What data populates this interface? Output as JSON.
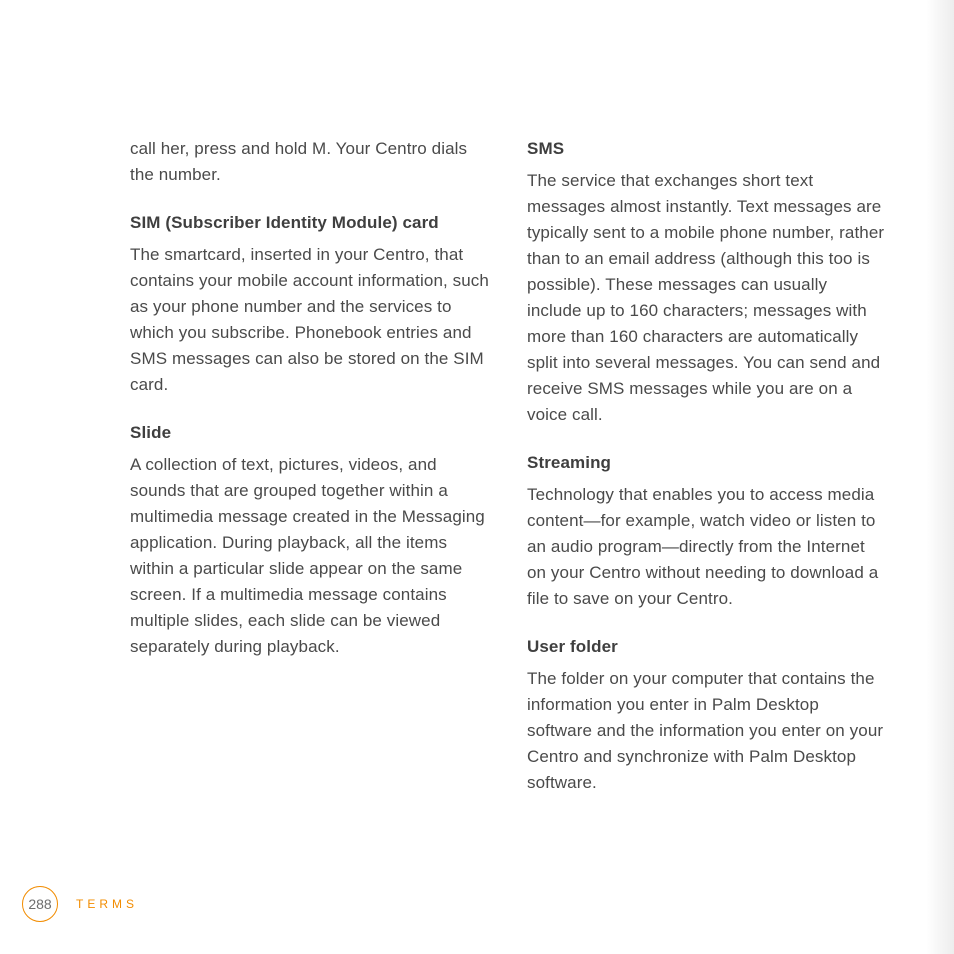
{
  "page_number": "288",
  "section_label": "TERMS",
  "left": {
    "lead": "call her, press and hold M. Your Centro dials the number.",
    "terms": [
      {
        "heading": "SIM (Subscriber Identity Module) card",
        "body": "The smartcard, inserted in your Centro, that contains your mobile account information, such as your phone number and the services to which you subscribe. Phonebook entries and SMS messages can also be stored on the SIM card."
      },
      {
        "heading": "Slide",
        "body": "A collection of text, pictures, videos, and sounds that are grouped together within a multimedia message created in the Messaging application. During playback, all the items within a particular slide appear on the same screen. If a multimedia message contains multiple slides, each slide can be viewed separately during playback."
      }
    ]
  },
  "right": {
    "terms": [
      {
        "heading": "SMS",
        "body": "The service that exchanges short text messages almost instantly. Text messages are typically sent to a mobile phone number, rather than to an email address (although this too is possible). These messages can usually include up to 160 characters; messages with more than 160 characters are automatically split into several messages. You can send and receive SMS messages while you are on a voice call."
      },
      {
        "heading": "Streaming",
        "body": "Technology that enables you to access media content—for example, watch video or listen to an audio program—directly from the Internet on your Centro without needing to download a file to save on your Centro."
      },
      {
        "heading": "User folder",
        "body": "The folder on your computer that contains the information you enter in Palm Desktop software and the information you enter on your Centro and synchronize with Palm Desktop software."
      }
    ]
  }
}
